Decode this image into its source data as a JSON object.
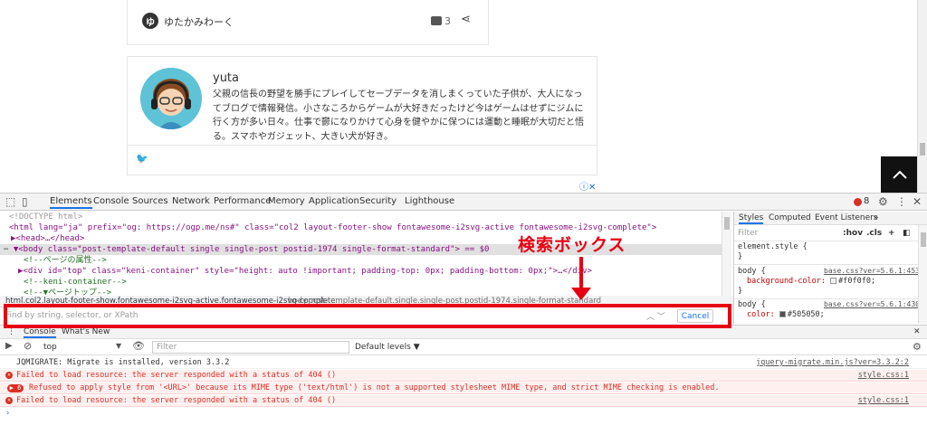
{
  "page": {
    "site_name": "ゆたかみわーく",
    "comment_count": "3",
    "author_name": "yuta",
    "author_bio": "父親の信長の野望を勝手にプレイしてセーブデータを消しまくっていた子供が、大人になってブログで情報発信。小さなころからゲームが大好きだったけど今はゲームはせずにジムに行く方が多い日々。仕事で鬱になりかけて心身を健やかに保つには運動と睡眠が大切だと悟る。スマホやガジェット、大きい犬が好き。",
    "twitter_icon": "twitter-icon",
    "scroll_top_icon": "chevron-up-icon"
  },
  "devtools": {
    "tabs": [
      "Elements",
      "Console",
      "Sources",
      "Network",
      "Performance",
      "Memory",
      "Application",
      "Security",
      "Lighthouse"
    ],
    "error_count": "8",
    "elements_lines": [
      {
        "text": "<!DOCTYPE html>"
      },
      {
        "text": "<html lang=\"ja\" prefix=\"og: https://ogp.me/ns#\" class=\"col2 layout-footer-show fontawesome-i2svg-active fontawesome-i2svg-complete\">"
      },
      {
        "text": "▶<head>…</head>"
      },
      {
        "text": "▼<body class=\"post-template-default single single-post postid-1974 single-format-standard\"> == $0"
      },
      {
        "text": "<!--ページの属性-->"
      },
      {
        "text": "▶<div id=\"top\" class=\"keni-container\" style=\"height: auto !important; padding-top: 0px; padding-bottom: 0px;\">…</div>"
      },
      {
        "text": "<!--keni-container-->"
      },
      {
        "text": "<!--▼ページトップ-->"
      }
    ],
    "breadcrumbs": [
      "html.col2.layout-footer-show.fontawesome-i2svg-active.fontawesome-i2svg-complete",
      "body.post-template-default.single.single-post.postid-1974.single-format-standard"
    ],
    "find": {
      "placeholder": "Find by string, selector, or XPath",
      "cancel_label": "Cancel"
    },
    "callout_label": "検索ボックス",
    "styles": {
      "tabs": [
        "Styles",
        "Computed",
        "Event Listeners",
        "»"
      ],
      "filter_placeholder": "Filter",
      "hov": ":hov",
      "cls": ".cls",
      "rules": [
        {
          "selector": "element.style {",
          "close": "}"
        },
        {
          "selector": "body {",
          "source": "base.css?ver=5.6.1:453",
          "prop": "background-color:",
          "value": "#f0f0f0;",
          "swatch": "#f0f0f0",
          "close": "}"
        },
        {
          "selector": "body {",
          "source": "base.css?ver=5.6.1:430",
          "prop": "color:",
          "value": "#505050;",
          "swatch": "#505050",
          "close": "}"
        }
      ]
    },
    "drawer": {
      "tabs": [
        "Console",
        "What's New"
      ],
      "context": "top",
      "filter_placeholder": "Filter",
      "levels": "Default levels ▼",
      "messages": [
        {
          "type": "log",
          "text": "JQMIGRATE: Migrate is installed, version 3.3.2",
          "source": "jquery-migrate.min.js?ver=3.3.2:2"
        },
        {
          "type": "error",
          "text": "Failed to load resource: the server responded with a status of 404 ()",
          "source": "style.css:1"
        },
        {
          "type": "error-repeat",
          "badge": "6",
          "text": "Refused to apply style from '<URL>' because its MIME type ('text/html') is not a supported stylesheet MIME type, and strict MIME checking is enabled.",
          "source": ""
        },
        {
          "type": "error",
          "text": "Failed to load resource: the server responded with a status of 404 ()",
          "source": "style.css:1"
        }
      ],
      "prompt": "›"
    }
  }
}
